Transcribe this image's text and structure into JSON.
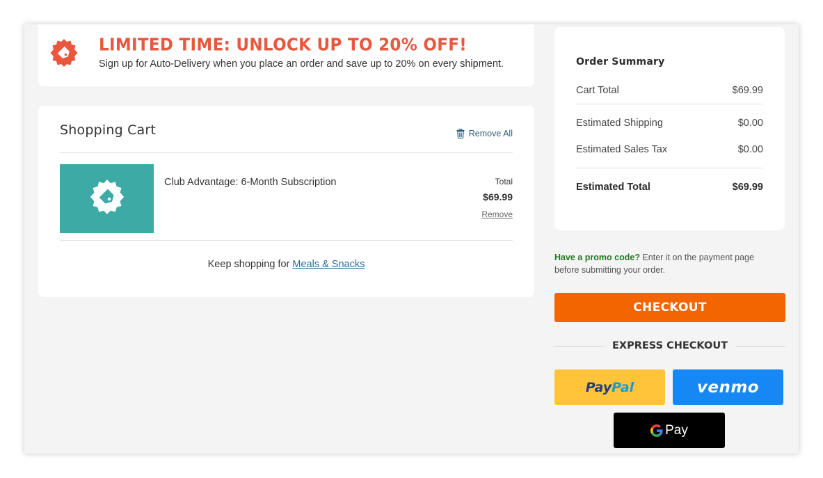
{
  "promo": {
    "title": "LIMITED TIME: UNLOCK UP TO 20% OFF!",
    "subtitle": "Sign up for Auto-Delivery when you place an order and save up to 20% on every shipment.",
    "icon": "tag-badge-icon",
    "accent_color": "#e8573e"
  },
  "cart": {
    "title": "Shopping Cart",
    "remove_all": "Remove All",
    "items": [
      {
        "name": "Club Advantage: 6-Month Subscription",
        "total_label": "Total",
        "price": "$69.99",
        "remove": "Remove",
        "thumb_color": "#3daaa6"
      }
    ],
    "keep_shopping_prefix": "Keep shopping for ",
    "keep_shopping_link": "Meals & Snacks"
  },
  "summary": {
    "title": "Order Summary",
    "rows": [
      {
        "label": "Cart Total",
        "value": "$69.99"
      },
      {
        "label": "Estimated Shipping",
        "value": "$0.00"
      },
      {
        "label": "Estimated Sales Tax",
        "value": "$0.00"
      },
      {
        "label": "Estimated Total",
        "value": "$69.99"
      }
    ]
  },
  "promo_code": {
    "bold": "Have a promo code?",
    "text": " Enter it on the payment page before submitting your order."
  },
  "checkout": {
    "label": "CHECKOUT",
    "color": "#f26500"
  },
  "express": {
    "label": "EXPRESS CHECKOUT",
    "paypal_part1": "Pay",
    "paypal_part2": "Pal",
    "venmo": "venmo",
    "gpay": "Pay"
  }
}
